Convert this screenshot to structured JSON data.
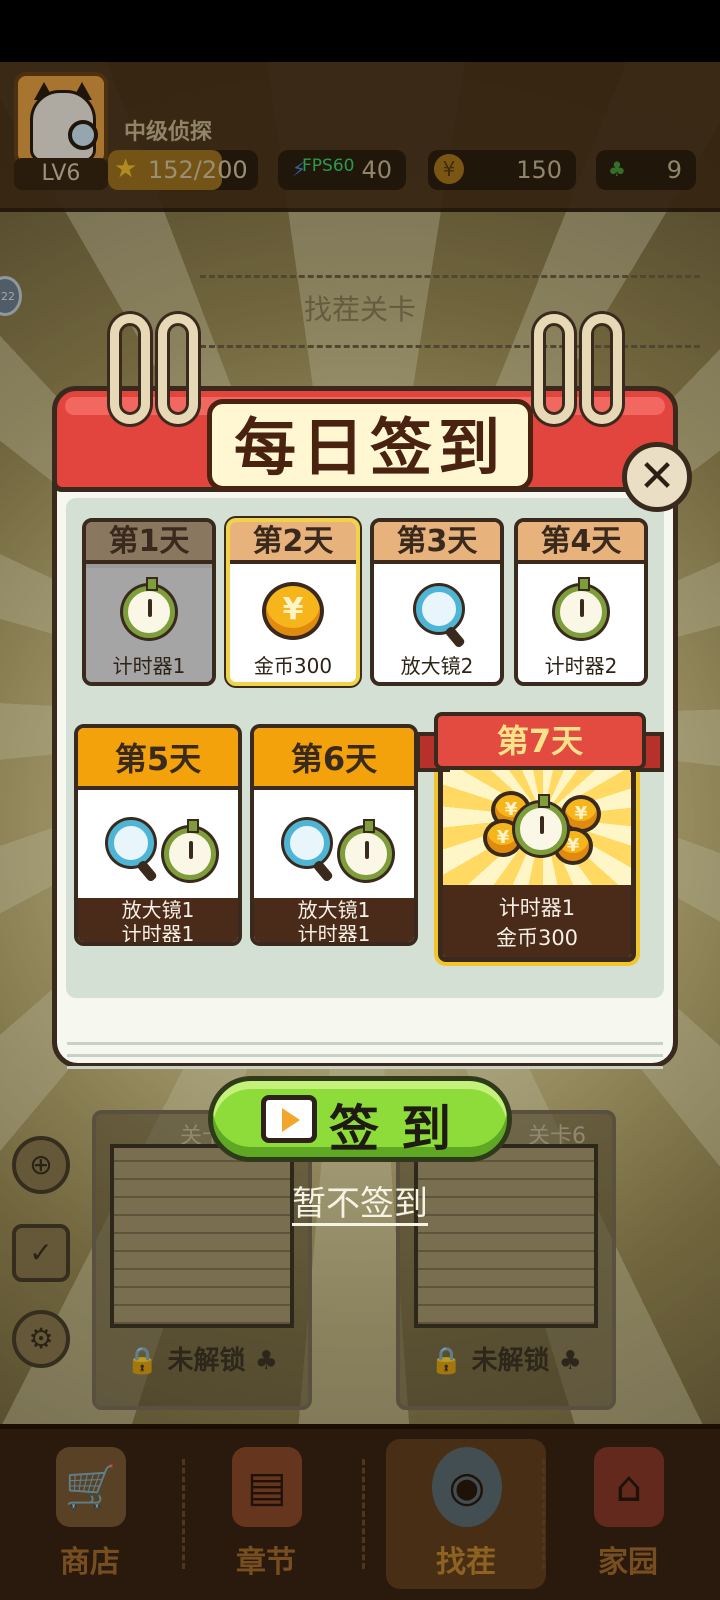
{
  "header": {
    "level": "LV6",
    "player_title": "中级侦探",
    "xp": "152/200",
    "xp_progress": 0.76,
    "fps": "FPS60",
    "energy": "40",
    "coins": "150",
    "clovers": "9"
  },
  "background": {
    "level_title": "找茬关卡",
    "side_bubble": "22",
    "cards": [
      {
        "caption": "关卡",
        "lock_label": "未解锁"
      },
      {
        "caption": "关卡6",
        "lock_label": "未解锁"
      }
    ]
  },
  "dialog": {
    "title": "每日签到",
    "days": [
      {
        "day": "第1天",
        "reward": "计时器1",
        "icon": "timer-icon",
        "state": "claimed"
      },
      {
        "day": "第2天",
        "reward": "金币300",
        "icon": "coin-icon",
        "state": "today"
      },
      {
        "day": "第3天",
        "reward": "放大镜2",
        "icon": "magnifier-icon",
        "state": "locked"
      },
      {
        "day": "第4天",
        "reward": "计时器2",
        "icon": "timer-icon",
        "state": "locked"
      },
      {
        "day": "第5天",
        "reward_line1": "放大镜1",
        "reward_line2": "计时器1",
        "icon": "magnifier-timer-icon",
        "state": "locked"
      },
      {
        "day": "第6天",
        "reward_line1": "放大镜1",
        "reward_line2": "计时器1",
        "icon": "magnifier-timer-icon",
        "state": "locked"
      },
      {
        "day": "第7天",
        "reward_line1": "计时器1",
        "reward_line2": "金币300",
        "icon": "coins-timer-icon",
        "state": "locked"
      }
    ],
    "sign_button": "签到",
    "skip_link": "暂不签到"
  },
  "bottom_nav": [
    {
      "label": "商店",
      "icon": "shop-cart-icon"
    },
    {
      "label": "章节",
      "icon": "chapter-book-icon"
    },
    {
      "label": "找茬",
      "icon": "magnifier-icon",
      "active": true
    },
    {
      "label": "家园",
      "icon": "home-icon"
    }
  ],
  "colors": {
    "accent_red": "#e2453e",
    "button_green": "#8ddc3a",
    "gold": "#f7b51c",
    "nav_brown": "#3b2312"
  }
}
